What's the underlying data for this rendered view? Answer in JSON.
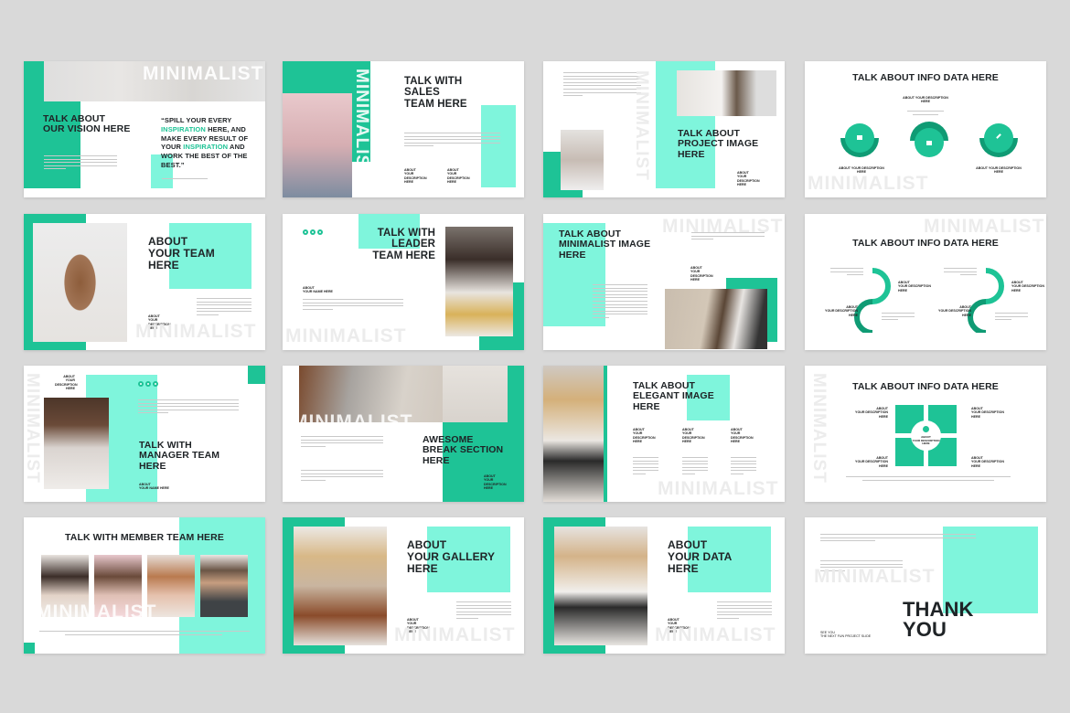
{
  "theme": {
    "accent_dark": "#1ec396",
    "accent_light": "#7ff5dc",
    "text": "#1f2326",
    "background": "#d9d9d9"
  },
  "watermark": "MINIMALIST",
  "slides": [
    {
      "title": "TALK ABOUT\nOUR VISION HERE",
      "quote_parts": [
        "“SPILL YOUR EVERY ",
        "INSPIRATION",
        " HERE, AND MAKE EVERY RESULT OF YOUR ",
        "INSPIRATION",
        " AND WORK THE BEST OF THE BEST.”"
      ]
    },
    {
      "title": "TALK WITH\nSALES\nTEAM HERE",
      "captions": [
        "ABOUT\nYOUR\nDESCRIPTION\nHERE",
        "ABOUT\nYOUR\nDESCRIPTION\nHERE"
      ]
    },
    {
      "title": "TALK ABOUT\nPROJECT IMAGE\nHERE",
      "captions": [
        "ABOUT\nYOUR\nDESCRIPTION\nHERE"
      ]
    },
    {
      "title": "TALK ABOUT INFO DATA HERE",
      "captions": [
        "ABOUT YOUR DESCRIPTION\nHERE",
        "ABOUT YOUR DESCRIPTION\nHERE",
        "ABOUT YOUR DESCRIPTION\nHERE"
      ],
      "icons": [
        "home-icon",
        "user-icon",
        "pencil-icon"
      ]
    },
    {
      "title": "ABOUT\nYOUR TEAM\nHERE",
      "captions": [
        "ABOUT\nYOUR\nDESCRIPTION\nHERE"
      ]
    },
    {
      "title": "TALK WITH\nLEADER\nTEAM HERE",
      "captions": [
        "ABOUT\nYOUR NAME HERE"
      ],
      "icons": [
        "phone-icon",
        "mail-icon",
        "chat-icon"
      ]
    },
    {
      "title": "TALK ABOUT\nMINIMALIST IMAGE\nHERE",
      "captions": [
        "ABOUT\nYOUR\nDESCRIPTION\nHERE"
      ]
    },
    {
      "title": "TALK ABOUT INFO DATA HERE",
      "captions": [
        "ABOUT\nYOUR DESCRIPTION\nHERE",
        "ABOUT\nYOUR DESCRIPTION\nHERE",
        "ABOUT\nYOUR DESCRIPTION\nHERE",
        "ABOUT\nYOUR DESCRIPTION\nHERE"
      ]
    },
    {
      "title": "TALK WITH\nMANAGER TEAM\nHERE",
      "captions": [
        "ABOUT\nYOUR\nDESCRIPTION\nHERE",
        "ABOUT\nYOUR NAME HERE"
      ],
      "icons": [
        "phone-icon",
        "mail-icon",
        "chat-icon"
      ]
    },
    {
      "title": "AWESOME\nBREAK SECTION\nHERE",
      "captions": [
        "ABOUT\nYOUR\nDESCRIPTION\nHERE"
      ]
    },
    {
      "title": "TALK ABOUT\nELEGANT IMAGE\nHERE",
      "captions": [
        "ABOUT\nYOUR\nDESCRIPTION\nHERE",
        "ABOUT\nYOUR\nDESCRIPTION\nHERE",
        "ABOUT\nYOUR\nDESCRIPTION\nHERE"
      ]
    },
    {
      "title": "TALK ABOUT INFO DATA HERE",
      "captions": [
        "ABOUT\nYOUR DESCRIPTION\nHERE",
        "ABOUT\nYOUR DESCRIPTION\nHERE",
        "ABOUT\nYOUR DESCRIPTION\nHERE",
        "ABOUT\nYOUR DESCRIPTION\nHERE",
        "ABOUT\nYOUR DESCRIPTION\nHERE"
      ]
    },
    {
      "title": "TALK WITH MEMBER TEAM HERE"
    },
    {
      "title": "ABOUT\nYOUR GALLERY\nHERE",
      "captions": [
        "ABOUT\nYOUR\nDESCRIPTION\nHERE"
      ]
    },
    {
      "title": "ABOUT\nYOUR DATA\nHERE",
      "captions": [
        "ABOUT\nYOUR\nDESCRIPTION\nHERE"
      ]
    },
    {
      "title": "THANK\nYOU",
      "captions": [
        "SEE YOU\nTHE NEXT FUN PROJECT SLIDE"
      ]
    }
  ]
}
